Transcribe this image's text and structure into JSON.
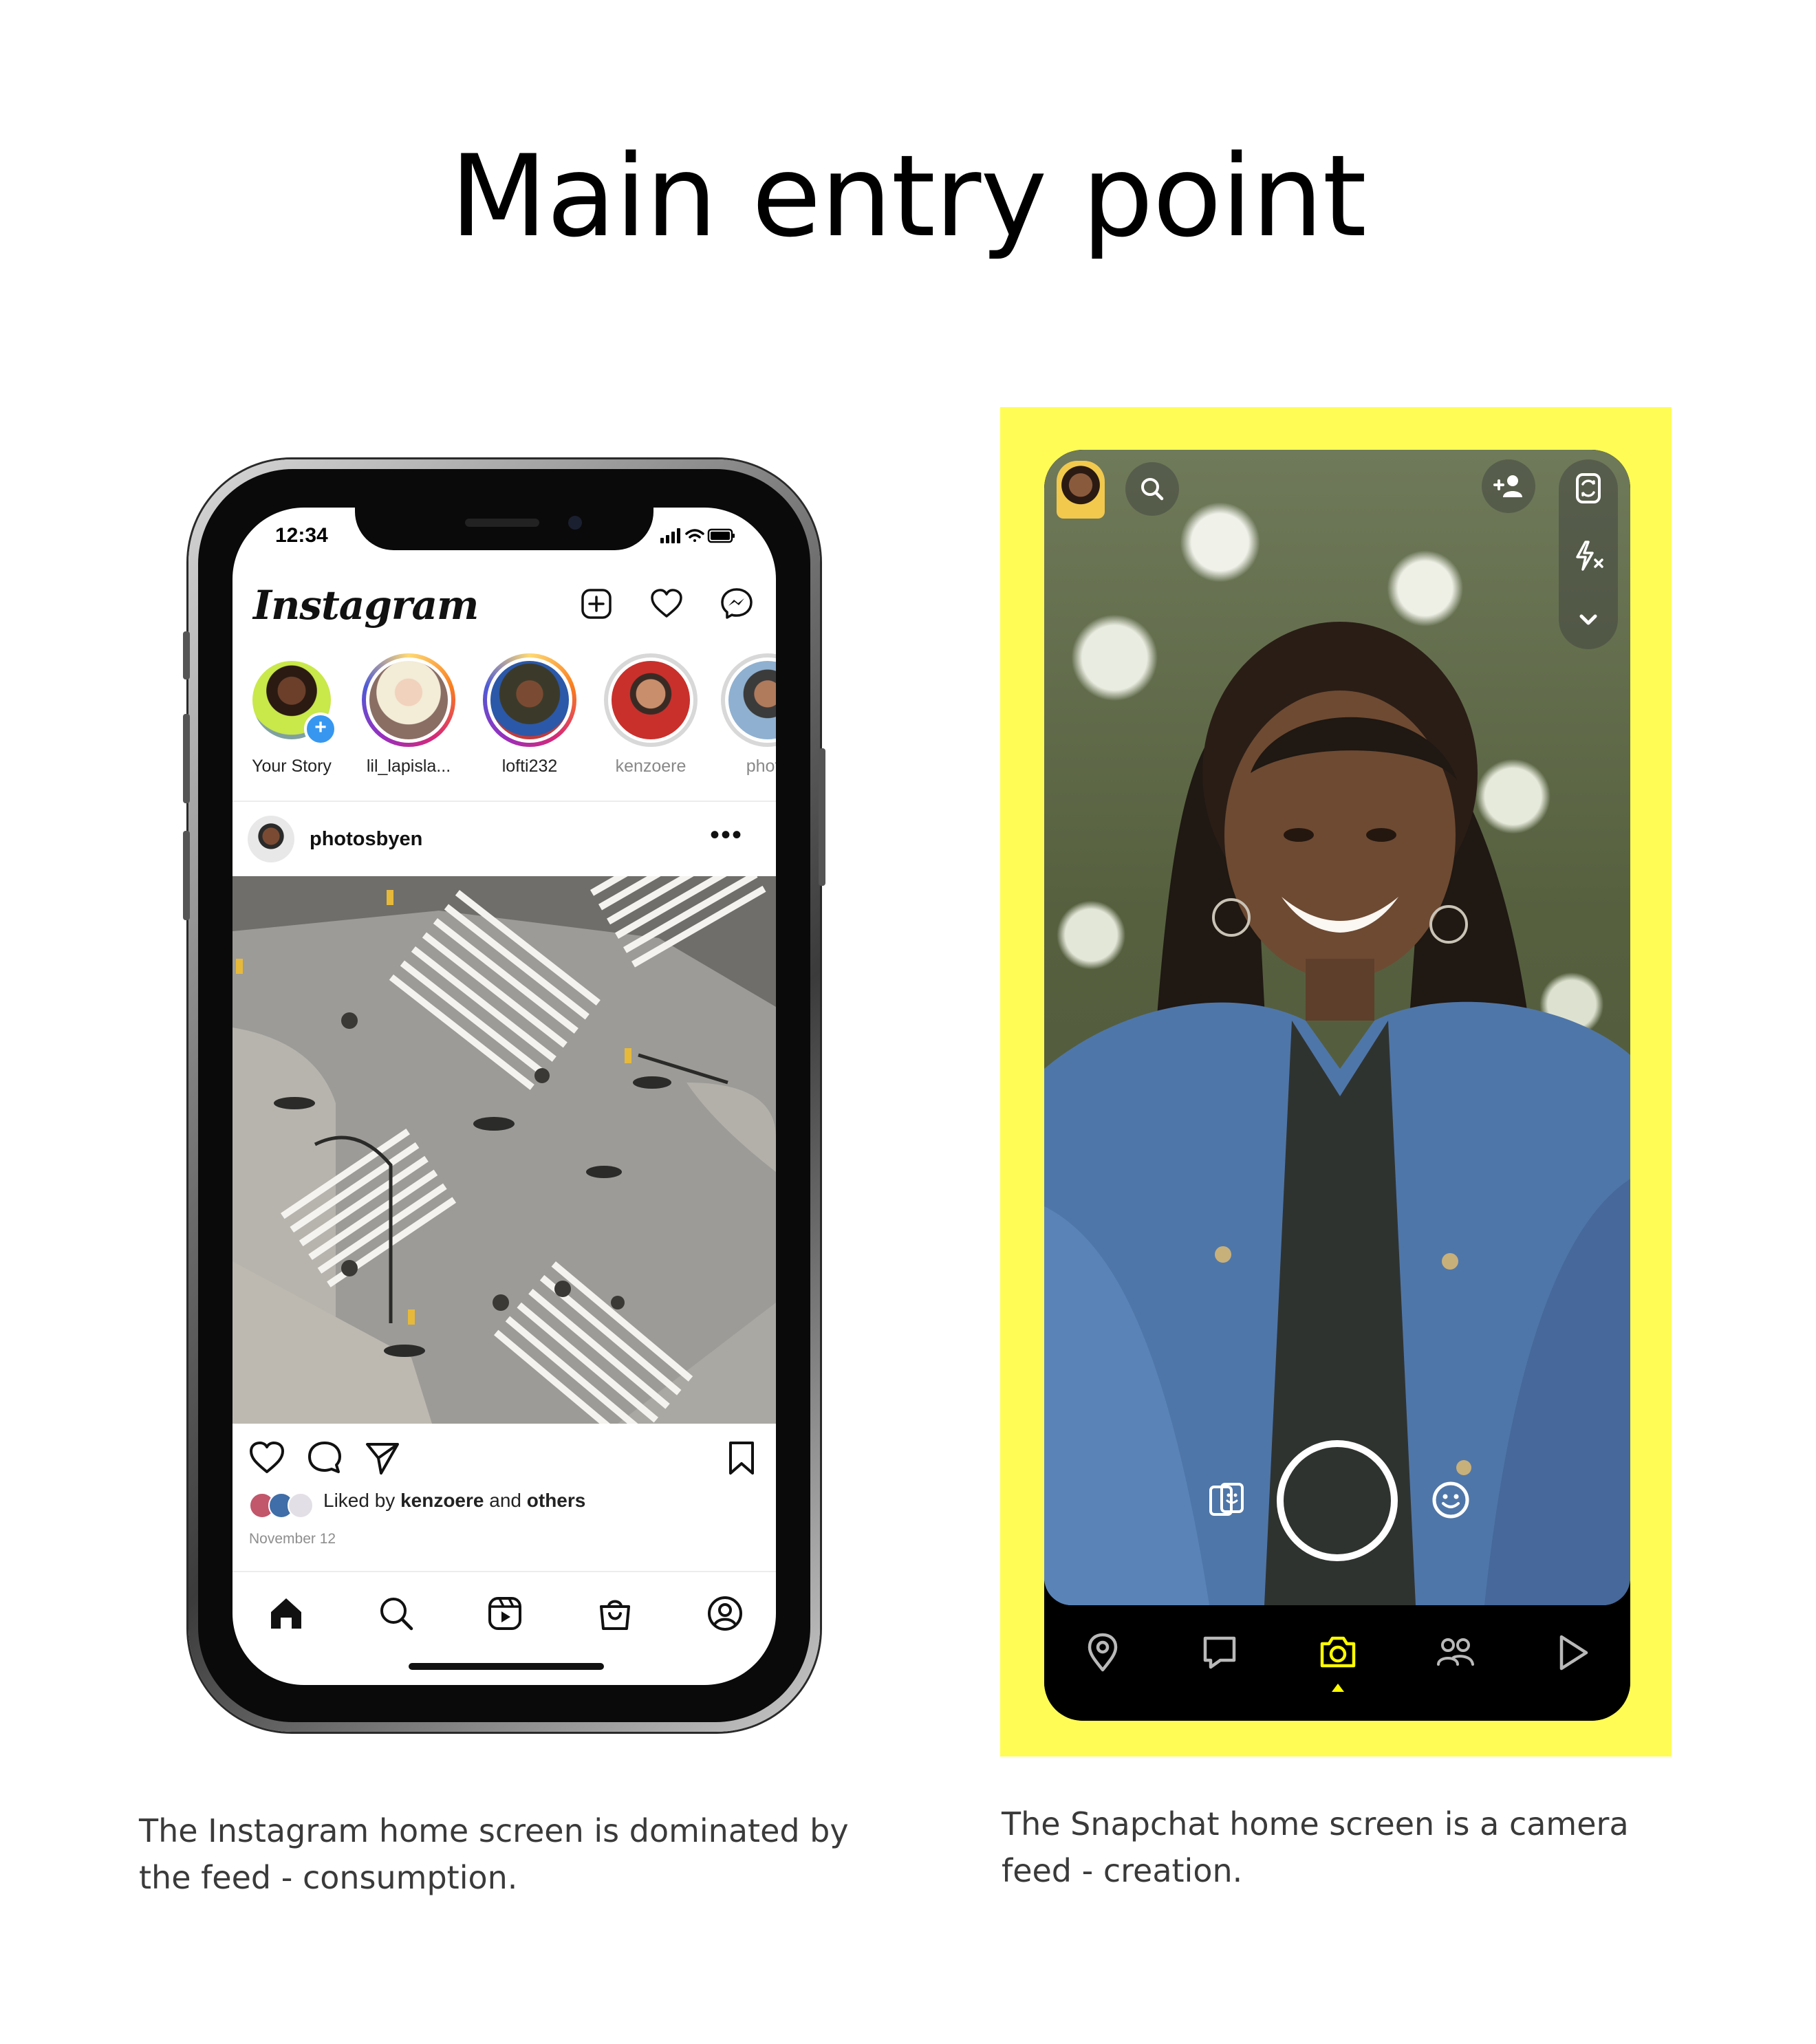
{
  "page": {
    "title": "Main entry point",
    "caption_left": "The Instagram home screen is dominated by the feed - consumption.",
    "caption_right": "The Snapchat home screen is a camera feed - creation."
  },
  "instagram": {
    "status_time": "12:34",
    "logo": "Instagram",
    "header_icons": [
      "new-post-icon",
      "heart-icon",
      "messenger-icon"
    ],
    "stories": [
      {
        "name": "Your Story",
        "ring": "none",
        "badge": "+"
      },
      {
        "name": "lil_lapisla...",
        "ring": "active"
      },
      {
        "name": "lofti232",
        "ring": "active"
      },
      {
        "name": "kenzoere",
        "ring": "seen"
      },
      {
        "name": "photo",
        "ring": "seen"
      }
    ],
    "post": {
      "username": "photosbyen",
      "more": "•••",
      "liked_prefix": "Liked by",
      "liked_user": "kenzoere",
      "liked_and": "and",
      "liked_others": "others",
      "date": "November 12"
    },
    "tabbar": [
      "home-icon",
      "search-icon",
      "reels-icon",
      "shop-icon",
      "profile-icon"
    ],
    "colors": {
      "story_badge": "#3797f0"
    }
  },
  "snapchat": {
    "top_left": [
      "bitmoji-avatar",
      "search-icon"
    ],
    "top_right": [
      "add-friend-icon",
      "flip-camera-icon",
      "flash-icon",
      "chevron-down-icon"
    ],
    "camera_controls": [
      "memories-icon",
      "shutter-button",
      "lenses-icon"
    ],
    "nav": [
      "map-icon",
      "chat-icon",
      "camera-icon",
      "friends-icon",
      "stories-icon"
    ],
    "active_nav": "camera-icon",
    "colors": {
      "frame": "#fffc56",
      "accent": "#fffc00"
    }
  }
}
